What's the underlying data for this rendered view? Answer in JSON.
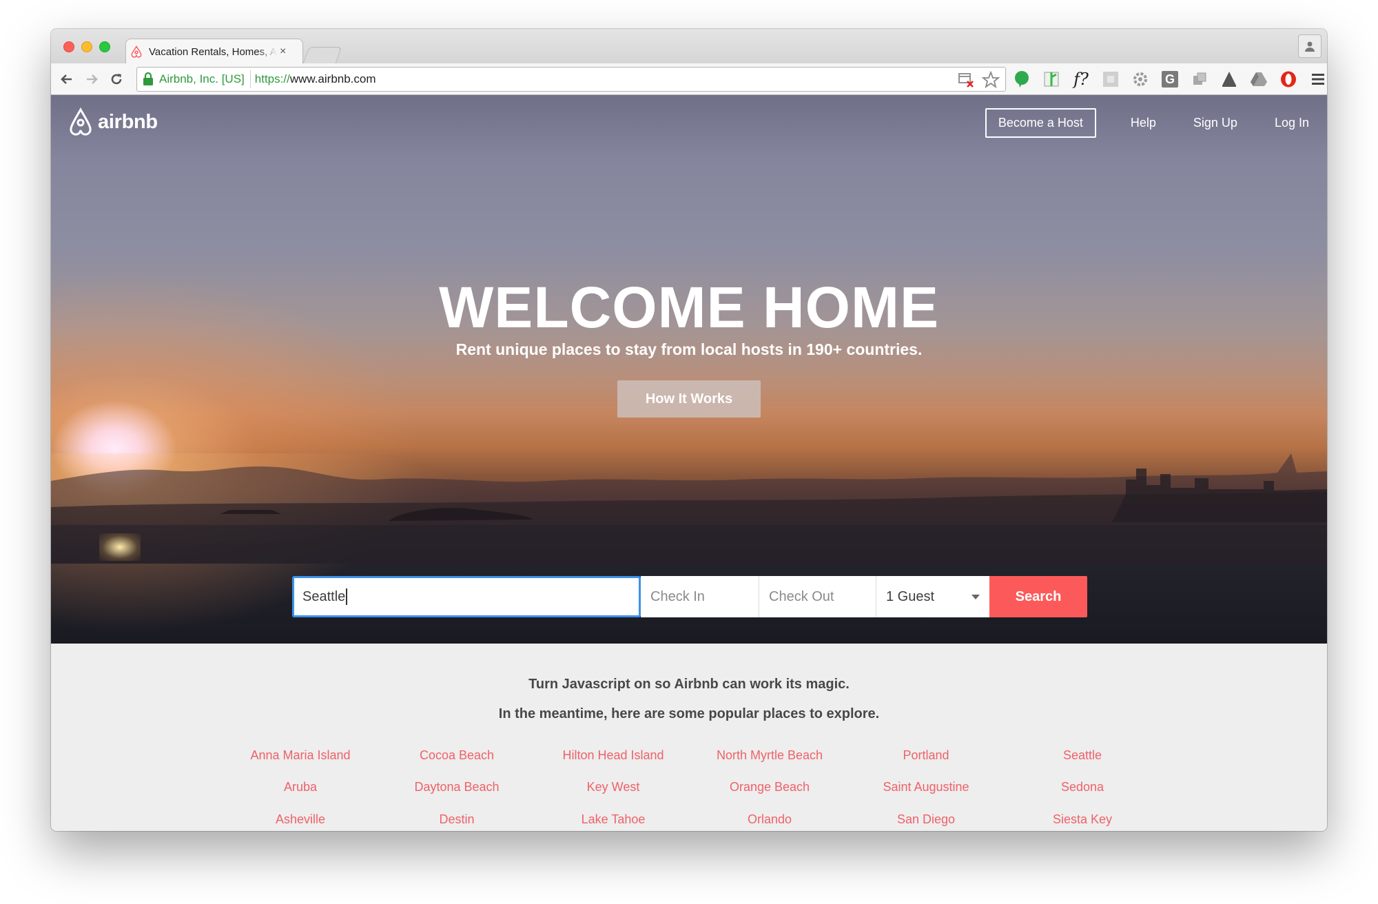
{
  "browser": {
    "tab_title": "Vacation Rentals, Homes, Apartments & Rooms for Rent - Airbnb",
    "tab_close": "×",
    "ev_label": "Airbnb, Inc. [US]",
    "url_scheme": "https://",
    "url_rest": "www.airbnb.com",
    "extensions": [
      "blocked-popup-icon",
      "star-icon",
      "evernote-icon",
      "ext-green-icon",
      "formula-icon",
      "ext-gray-square-icon",
      "settings-icon",
      "grammarly-icon",
      "ext-puzzle-icon",
      "ext-triangle-icon",
      "drive-icon",
      "opera-icon",
      "menu-icon"
    ],
    "formula_label": "f?",
    "grammarly_label": "G"
  },
  "header": {
    "logo_text": "airbnb",
    "become_host": "Become a Host",
    "help": "Help",
    "sign_up": "Sign Up",
    "log_in": "Log In"
  },
  "hero": {
    "title": "WELCOME HOME",
    "subtitle": "Rent unique places to stay from local hosts in 190+ countries.",
    "how_it_works": "How It Works"
  },
  "search": {
    "location_value": "Seattle",
    "check_in_placeholder": "Check In",
    "check_out_placeholder": "Check Out",
    "guests_value": "1 Guest",
    "search_button": "Search"
  },
  "content": {
    "notice_line1": "Turn Javascript on so Airbnb can work its magic.",
    "notice_line2": "In the meantime, here are some popular places to explore.",
    "places": [
      [
        "Anna Maria Island",
        "Cocoa Beach",
        "Hilton Head Island",
        "North Myrtle Beach",
        "Portland",
        "Seattle"
      ],
      [
        "Aruba",
        "Daytona Beach",
        "Key West",
        "Orange Beach",
        "Saint Augustine",
        "Sedona"
      ],
      [
        "Asheville",
        "Destin",
        "Lake Tahoe",
        "Orlando",
        "San Diego",
        "Siesta Key"
      ]
    ]
  },
  "colors": {
    "brand": "#fc5a5a",
    "link": "#f0616a",
    "focus_border": "#3d92e8",
    "ev_green": "#2e9a3c"
  }
}
